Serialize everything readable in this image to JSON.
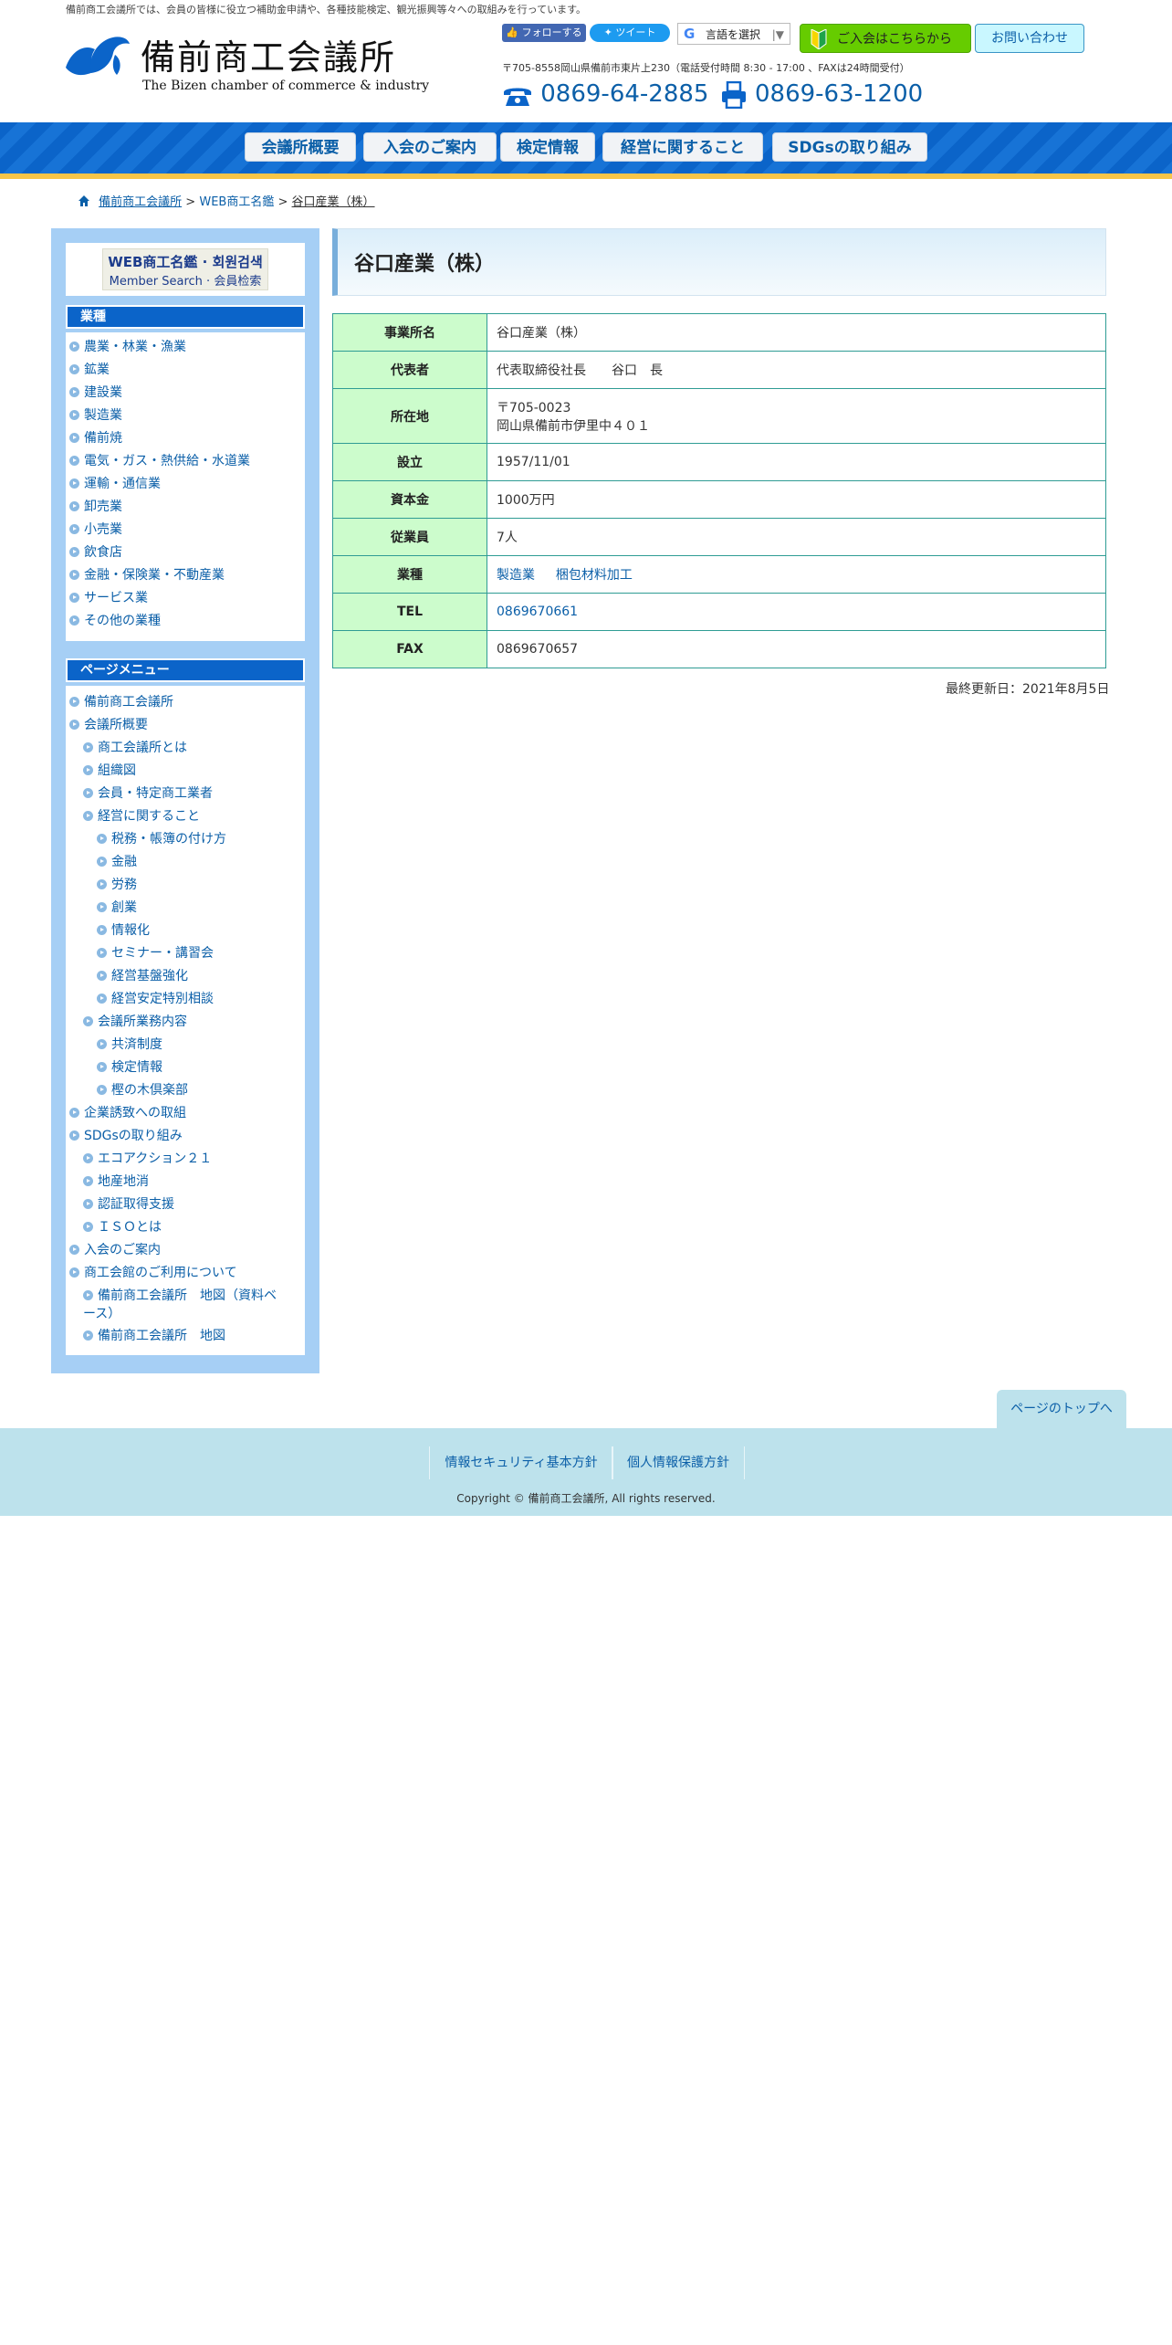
{
  "header": {
    "tagline": "備前商工会議所では、会員の皆様に役立つ補助金申請や、各種技能検定、観光振興等々への取組みを行っています。",
    "logo_title": "備前商工会議所",
    "logo_subtitle": "The Bizen chamber of commerce & industry",
    "facebook_label": "フォローする",
    "tweet_label": "ツイート",
    "translate_label": "言語を選択",
    "join_label": "ご入会はこちらから",
    "contact_label": "お問い合わせ",
    "address": "〒705-8558岡山県備前市東片上230（電話受付時間 8:30 - 17:00 、FAXは24時間受付）",
    "tel": "0869-64-2885",
    "fax": "0869-63-1200",
    "brand_color": "#0b64c9",
    "accent_color": "#f7c548"
  },
  "nav": [
    "会議所概要",
    "入会のご案内",
    "検定情報",
    "経営に関すること",
    "SDGsの取り組み"
  ],
  "breadcrumb": {
    "home": "備前商工会議所",
    "sep1": ">",
    "level2": "WEB商工名鑑",
    "sep2": ">",
    "current": "谷口産業（株）"
  },
  "sidebar": {
    "banner_line1": "WEB商工名鑑 · 회원검색",
    "banner_line2": "Member Search · 会員检索",
    "industry_heading": "業種",
    "industries": [
      "農業・林業・漁業",
      "鉱業",
      "建設業",
      "製造業",
      "備前焼",
      "電気・ガス・熱供給・水道業",
      "運輸・通信業",
      "卸売業",
      "小売業",
      "飲食店",
      "金融・保険業・不動産業",
      "サービス業",
      "その他の業種"
    ],
    "menu_heading": "ページメニュー",
    "menu": [
      {
        "label": "備前商工会議所",
        "level": 0
      },
      {
        "label": "会議所概要",
        "level": 0
      },
      {
        "label": "商工会議所とは",
        "level": 1
      },
      {
        "label": "組織図",
        "level": 1
      },
      {
        "label": "会員・特定商工業者",
        "level": 1
      },
      {
        "label": "経営に関すること",
        "level": 1
      },
      {
        "label": "税務・帳簿の付け方",
        "level": 2
      },
      {
        "label": "金融",
        "level": 2
      },
      {
        "label": "労務",
        "level": 2
      },
      {
        "label": "創業",
        "level": 2
      },
      {
        "label": "情報化",
        "level": 2
      },
      {
        "label": "セミナー・講習会",
        "level": 2
      },
      {
        "label": "経営基盤強化",
        "level": 2
      },
      {
        "label": "経営安定特別相談",
        "level": 2
      },
      {
        "label": "会議所業務内容",
        "level": 1
      },
      {
        "label": "共済制度",
        "level": 2
      },
      {
        "label": "検定情報",
        "level": 2
      },
      {
        "label": "樫の木倶楽部",
        "level": 2
      },
      {
        "label": "企業誘致への取組",
        "level": 0
      },
      {
        "label": "SDGsの取り組み",
        "level": 0
      },
      {
        "label": "エコアクション２１",
        "level": 1
      },
      {
        "label": "地産地消",
        "level": 1
      },
      {
        "label": "認証取得支援",
        "level": 1
      },
      {
        "label": "ＩＳＯとは",
        "level": 1
      },
      {
        "label": "入会のご案内",
        "level": 0
      },
      {
        "label": "商工会館のご利用について",
        "level": 0
      },
      {
        "label": "備前商工会議所　地図（資料ベース）",
        "level": 1
      },
      {
        "label": "備前商工会議所　地図",
        "level": 1
      }
    ]
  },
  "main": {
    "title": "谷口産業（株）",
    "rows": [
      {
        "label": "事業所名",
        "value": "谷口産業（株）"
      },
      {
        "label": "代表者",
        "value": "代表取締役社長　　谷口　長"
      },
      {
        "label": "所在地",
        "value_line1": "〒705-0023",
        "value_line2": "岡山県備前市伊里中４０１"
      },
      {
        "label": "設立",
        "value": "1957/11/01"
      },
      {
        "label": "資本金",
        "value": "1000万円"
      },
      {
        "label": "従業員",
        "value": "7人"
      },
      {
        "label": "業種",
        "value_a": "製造業",
        "value_b": "梱包材料加工"
      },
      {
        "label": "TEL",
        "value": "0869670661"
      },
      {
        "label": "FAX",
        "value": "0869670657"
      }
    ],
    "updated": "最終更新日：2021年8月5日"
  },
  "footer": {
    "page_top": "ページのトップへ",
    "links": [
      "情報セキュリティ基本方針",
      "個人情報保護方針"
    ],
    "copyright": "Copyright © 備前商工会議所, All rights reserved."
  }
}
